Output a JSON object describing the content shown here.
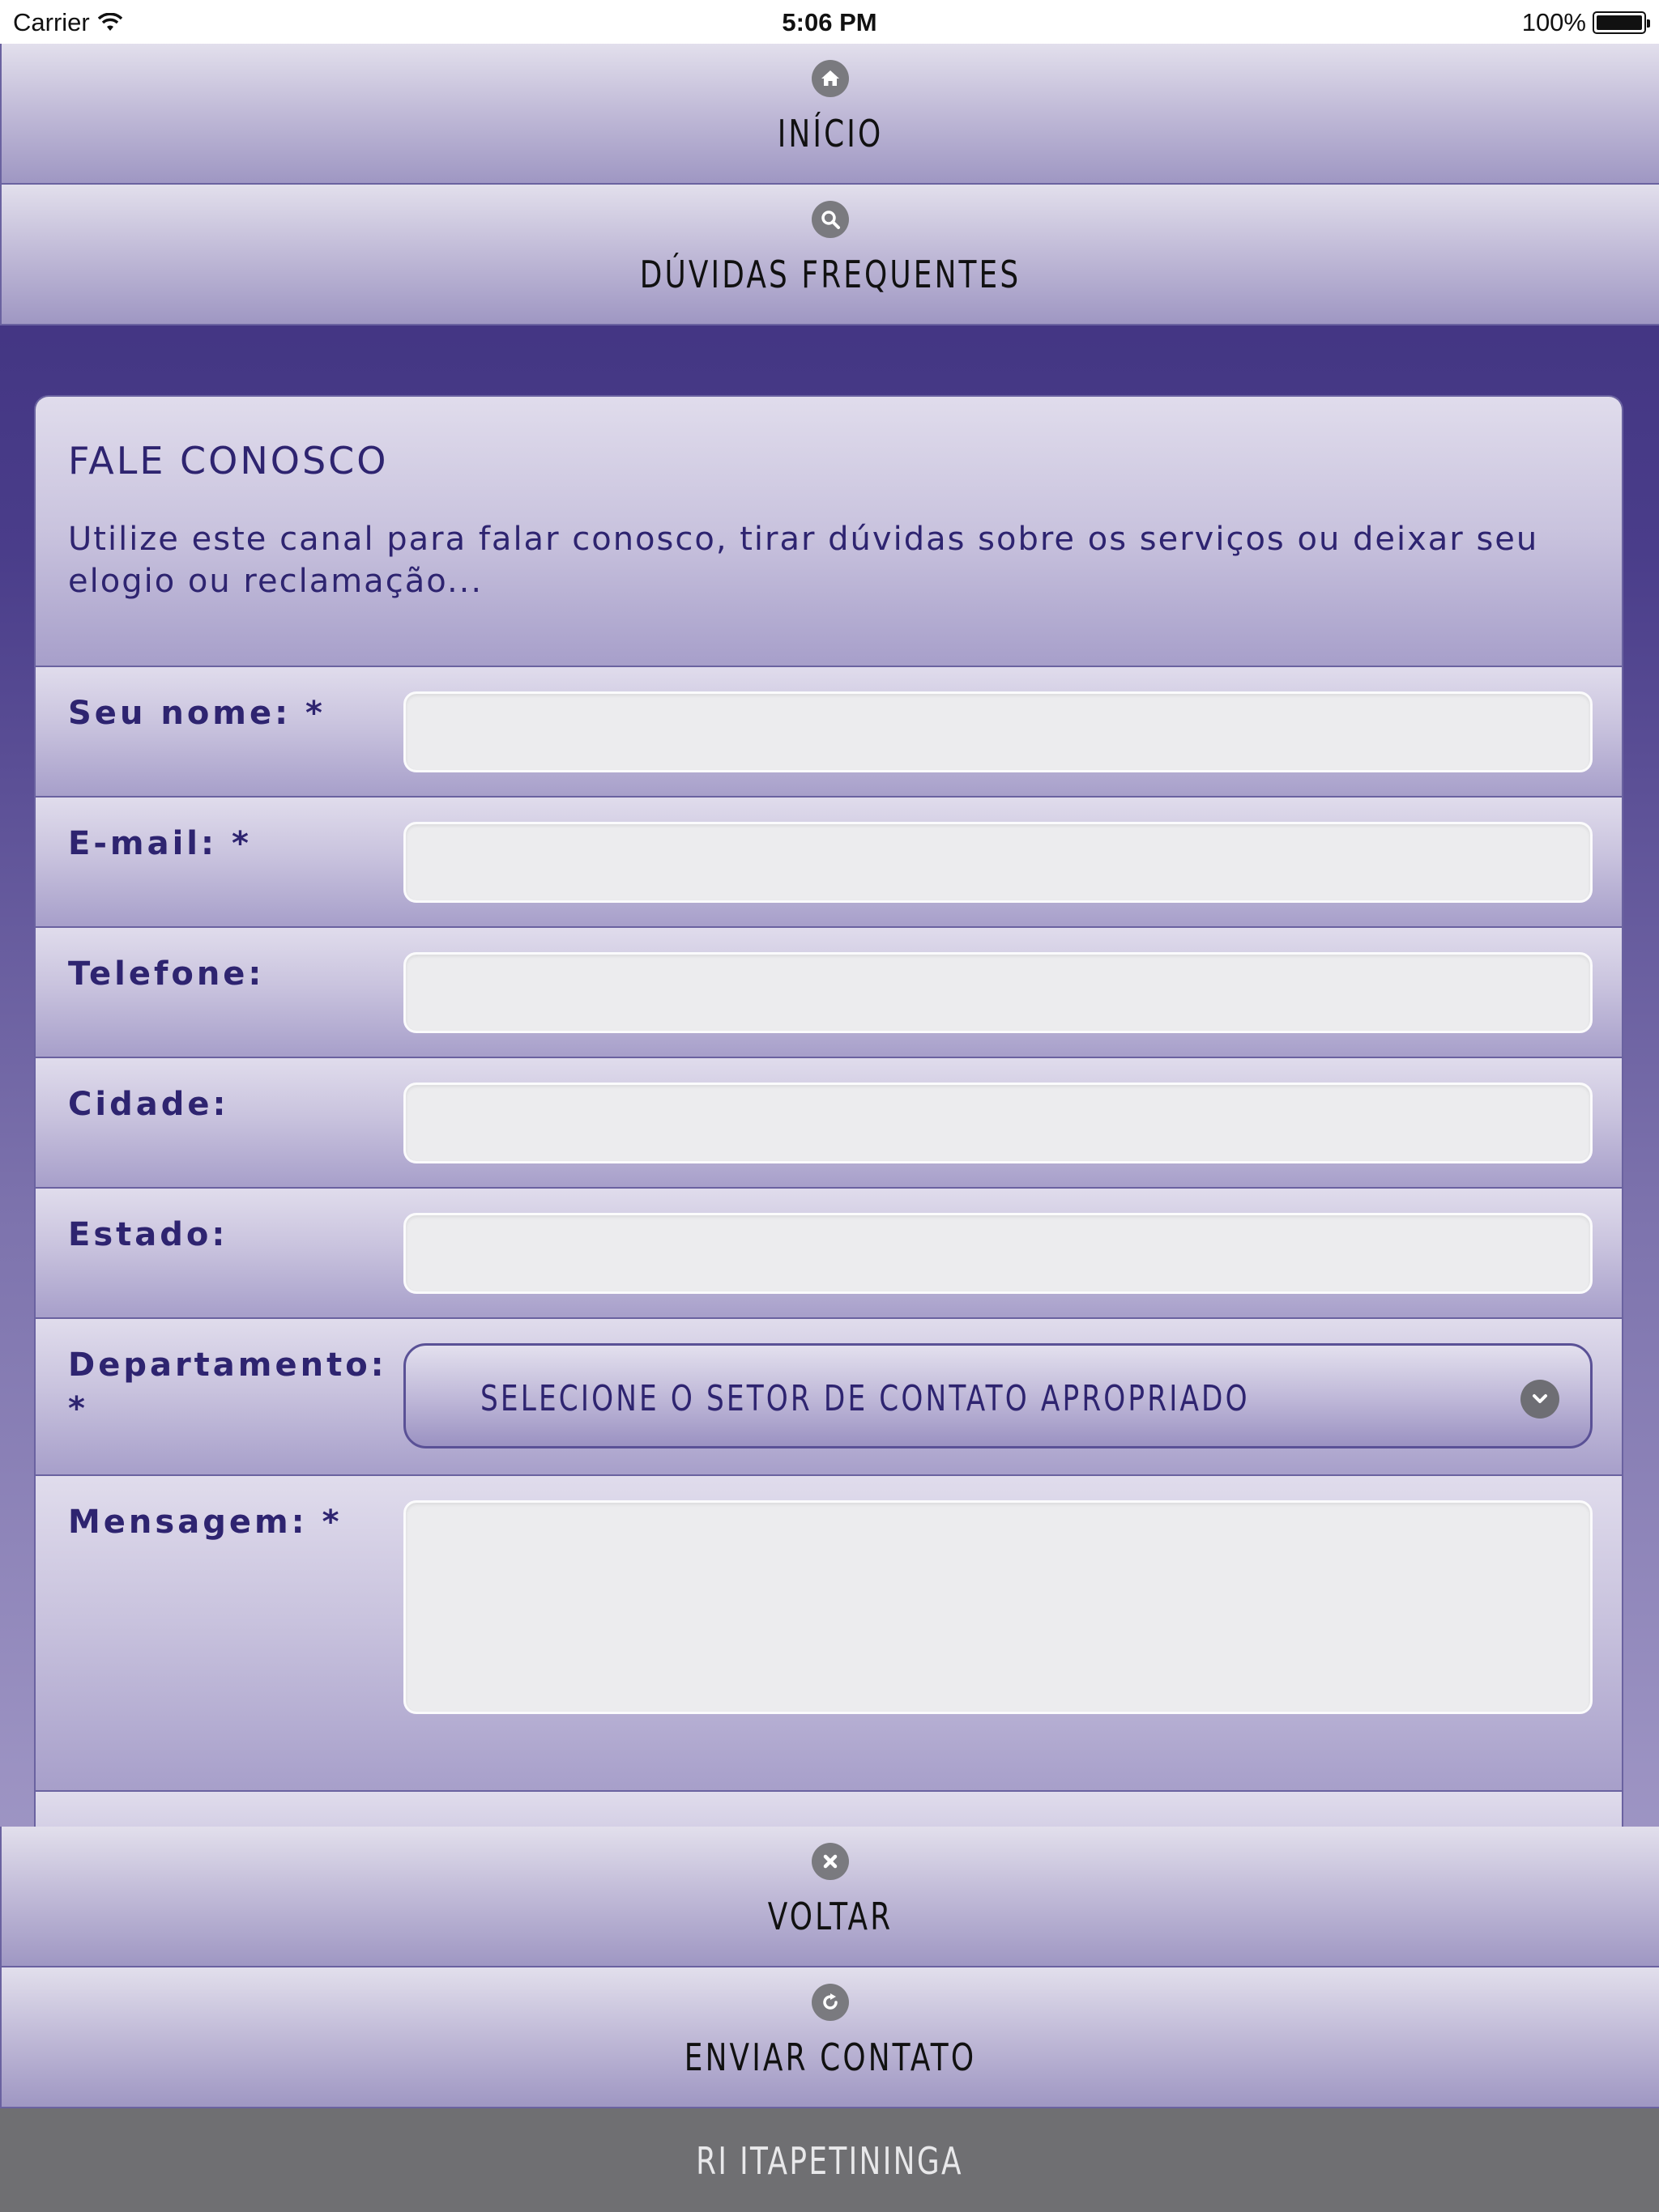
{
  "status_bar": {
    "carrier": "Carrier",
    "time": "5:06 PM",
    "battery": "100%"
  },
  "top_nav": {
    "home": {
      "label": "INÍCIO",
      "icon": "home-icon"
    },
    "faq": {
      "label": "DÚVIDAS FREQUENTES",
      "icon": "search-icon"
    }
  },
  "form": {
    "title": "FALE CONOSCO",
    "description": "Utilize este canal para falar conosco, tirar dúvidas sobre os serviços ou deixar seu elogio ou reclamação...",
    "fields": {
      "name": {
        "label": "Seu nome: *",
        "value": ""
      },
      "email": {
        "label": "E-mail: *",
        "value": ""
      },
      "phone": {
        "label": "Telefone:",
        "value": ""
      },
      "city": {
        "label": "Cidade:",
        "value": ""
      },
      "state": {
        "label": "Estado:",
        "value": ""
      },
      "department": {
        "label": "Departamento: *",
        "selected": "SELECIONE O SETOR DE CONTATO APROPRIADO"
      },
      "message": {
        "label": "Mensagem: *",
        "value": ""
      }
    }
  },
  "bottom_nav": {
    "back": {
      "label": "VOLTAR",
      "icon": "close-icon"
    },
    "send": {
      "label": "ENVIAR CONTATO",
      "icon": "refresh-icon"
    }
  },
  "footer": {
    "text": "RI ITAPETININGA"
  },
  "colors": {
    "accent_text": "#2e2470",
    "background_top": "#3a2c7a",
    "footer_bg": "#6f6f72",
    "input_bg": "#ececee"
  }
}
